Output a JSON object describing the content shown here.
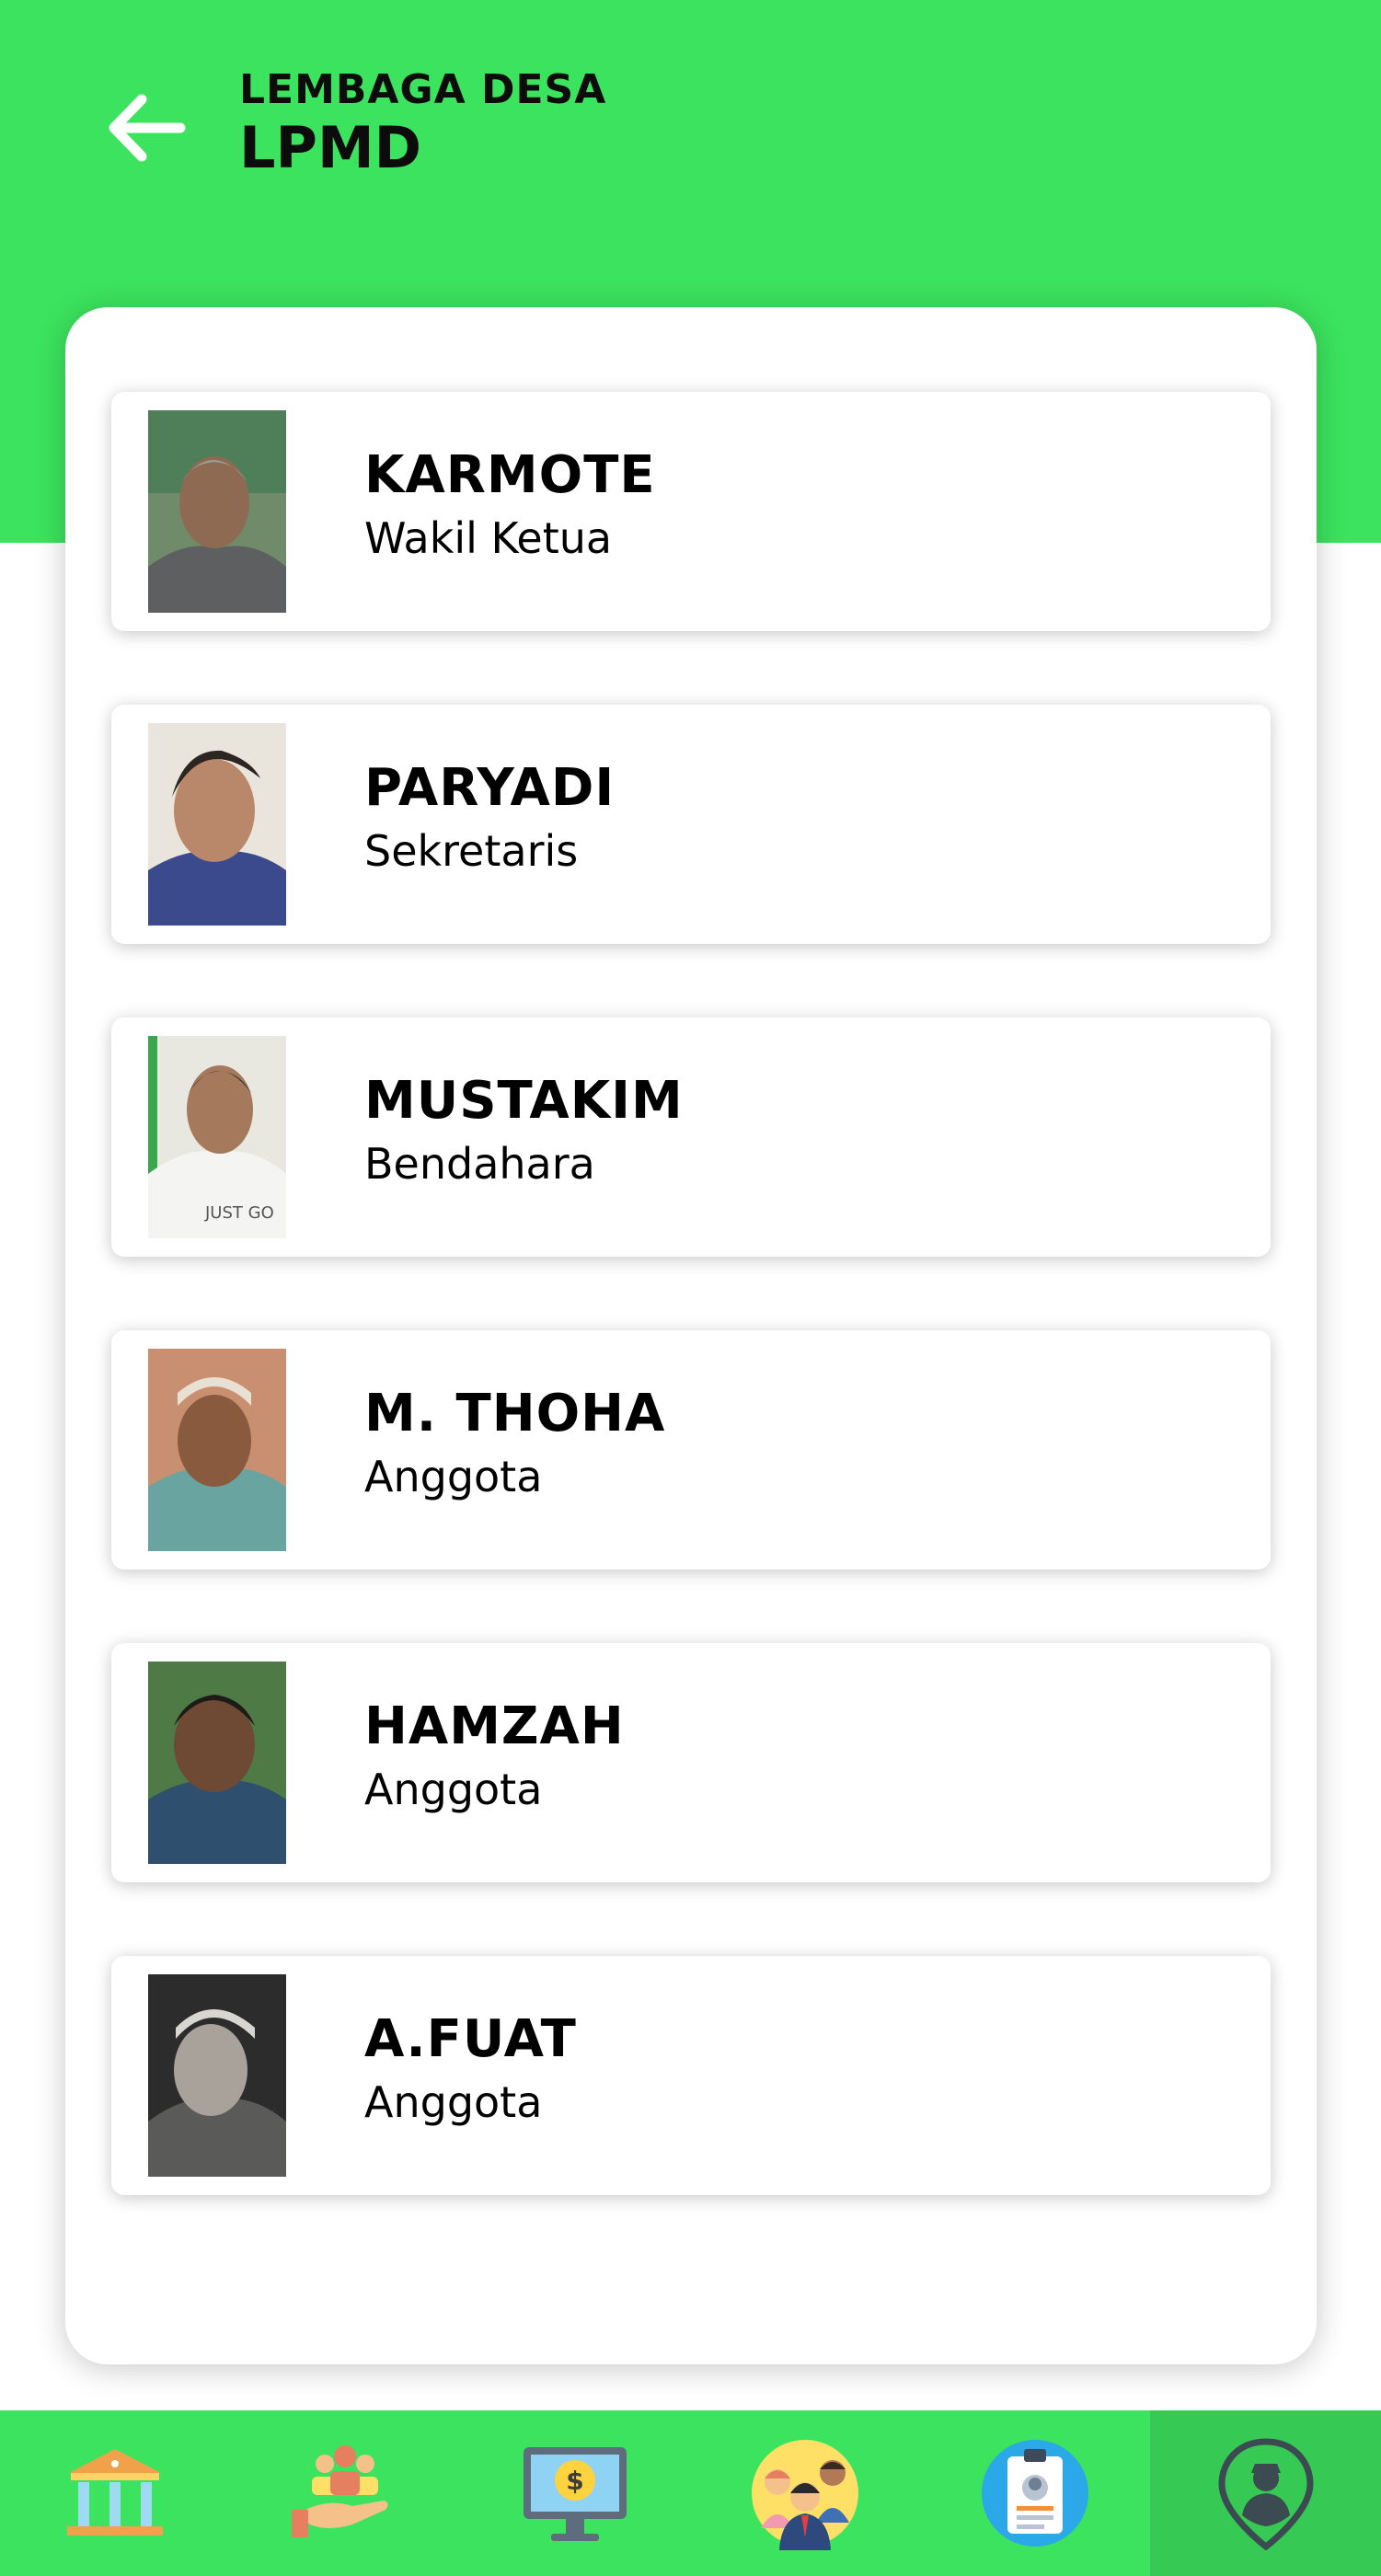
{
  "header": {
    "subtitle": "LEMBAGA DESA",
    "title": "LPMD"
  },
  "members": [
    {
      "name": "KARMOTE",
      "role": "Wakil Ketua"
    },
    {
      "name": "PARYADI",
      "role": "Sekretaris"
    },
    {
      "name": "MUSTAKIM",
      "role": "Bendahara"
    },
    {
      "name": "M. THOHA",
      "role": "Anggota"
    },
    {
      "name": "HAMZAH",
      "role": "Anggota"
    },
    {
      "name": "A.FUAT",
      "role": "Anggota"
    }
  ],
  "photos": [
    {
      "shirt": "t-shirt printed \"JUST GO\"",
      "print": "JUST GO"
    }
  ],
  "bottom_nav": [
    {
      "icon": "bank-building-icon"
    },
    {
      "icon": "community-hand-icon"
    },
    {
      "icon": "budget-monitor-icon"
    },
    {
      "icon": "people-group-icon"
    },
    {
      "icon": "id-card-icon"
    },
    {
      "icon": "location-person-icon",
      "active": true
    }
  ],
  "colors": {
    "header_green": "#3ce35e",
    "nav_active": "#36c954"
  }
}
